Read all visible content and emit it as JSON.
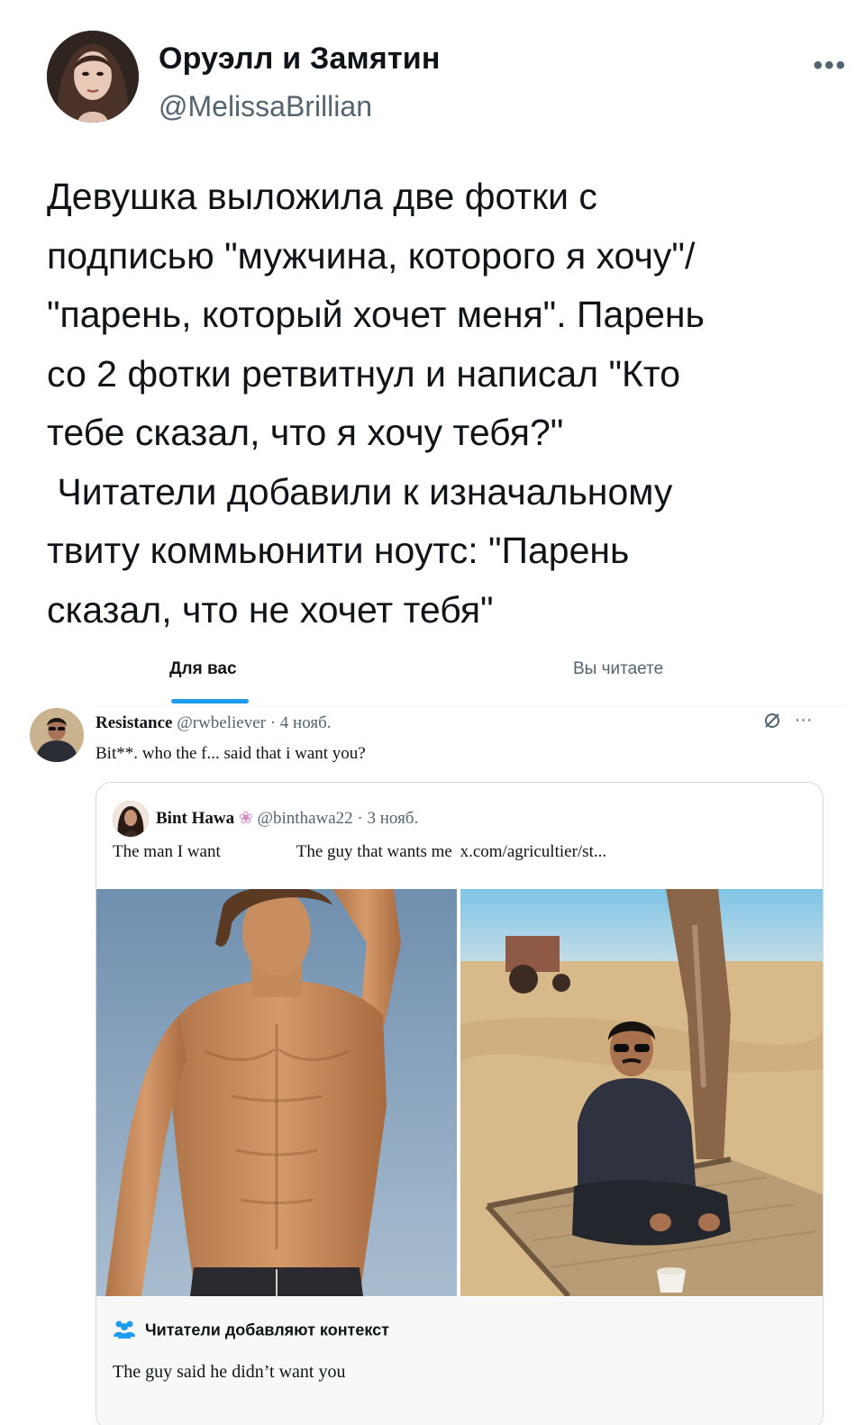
{
  "outer_tweet": {
    "display_name": "Оруэлл и Замятин",
    "handle": "@MelissaBrillian",
    "more": "•••",
    "text_lines": [
      "Девушка выложила две фотки с",
      "подписью \"мужчина, которого я хочу\"/",
      "\"парень, который хочет меня\". Парень",
      "со 2 фотки ретвитнул и написал \"Кто",
      "тебе сказал, что я хочу тебя?\"",
      " Читатели добавили к изначальному",
      "твиту коммьюнити ноутс: \"Парень",
      "сказал, что не хочет тебя\""
    ]
  },
  "tabs": {
    "for_you": "Для вас",
    "following": "Вы читаете"
  },
  "inner_tweet": {
    "display_name": "Resistance",
    "handle": "@rwbeliever",
    "date": "· 4 нояб.",
    "text": "Bit**. who the f... said that i want you?",
    "icons": [
      "grok-icon",
      "more-icon"
    ],
    "more": "···"
  },
  "quoted_tweet": {
    "display_name": "Bint Hawa",
    "flower": "❀",
    "handle": "@binthawa22",
    "date": "· 3 нояб.",
    "caption_left": "The man I want",
    "caption_right": "The guy that wants me",
    "link": "x.com/agricultier/st...",
    "photos": [
      "shirtless-model-photo",
      "man-sitting-in-field-photo"
    ]
  },
  "community_note": {
    "title": "Читатели добавляют контекст",
    "body": "The guy said he didn’t want you"
  },
  "colors": {
    "accent": "#1d9bf0",
    "secondary_text": "#536471",
    "primary_text": "#0f1419",
    "border": "#cfd9de"
  }
}
